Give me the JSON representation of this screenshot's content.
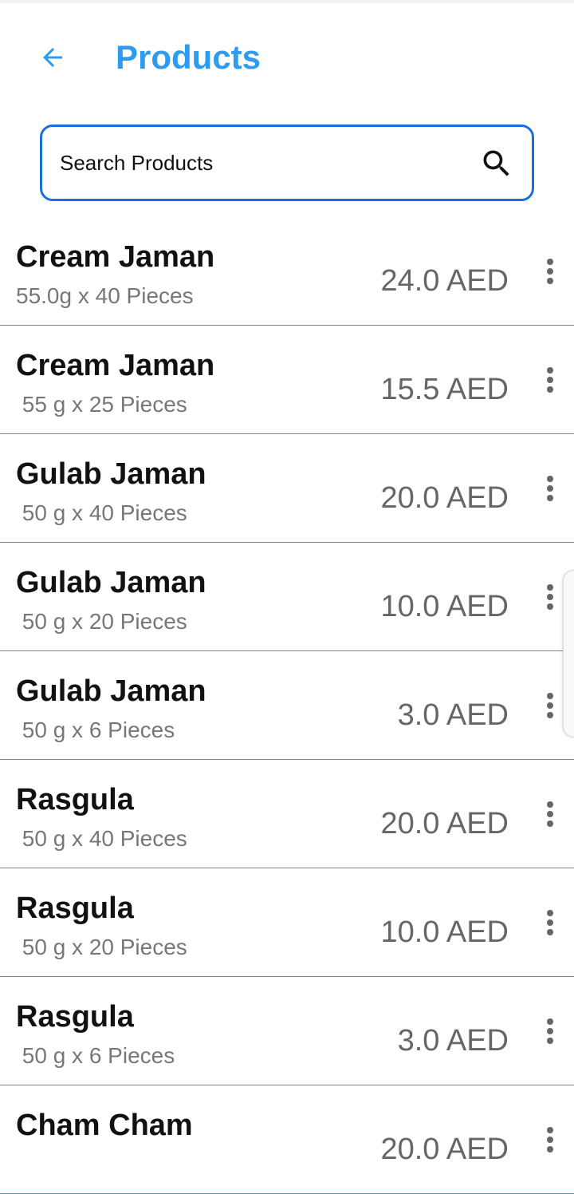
{
  "header": {
    "title": "Products",
    "back_icon": "arrow-left-icon",
    "accent_color": "#2f9bef"
  },
  "search": {
    "placeholder": "Search Products",
    "value": "",
    "icon": "search-icon",
    "border_color": "#1a6fe0"
  },
  "products": [
    {
      "name": "Cream Jaman",
      "desc": "55.0g x 40 Pieces",
      "price": "24.0 AED"
    },
    {
      "name": "Cream Jaman",
      "desc": " 55 g x 25 Pieces",
      "price": "15.5 AED"
    },
    {
      "name": "Gulab Jaman",
      "desc": " 50 g x 40 Pieces",
      "price": "20.0 AED"
    },
    {
      "name": "Gulab Jaman",
      "desc": " 50 g x 20 Pieces",
      "price": "10.0 AED"
    },
    {
      "name": "Gulab Jaman",
      "desc": " 50 g x 6 Pieces",
      "price": "3.0 AED"
    },
    {
      "name": "Rasgula",
      "desc": " 50 g x 40 Pieces",
      "price": "20.0 AED"
    },
    {
      "name": "Rasgula",
      "desc": " 50 g x 20 Pieces",
      "price": "10.0 AED"
    },
    {
      "name": "Rasgula",
      "desc": " 50 g x 6 Pieces",
      "price": "3.0 AED"
    },
    {
      "name": "Cham Cham",
      "desc": "",
      "price": "20.0 AED"
    }
  ],
  "row_menu_icon": "more-vertical-icon"
}
